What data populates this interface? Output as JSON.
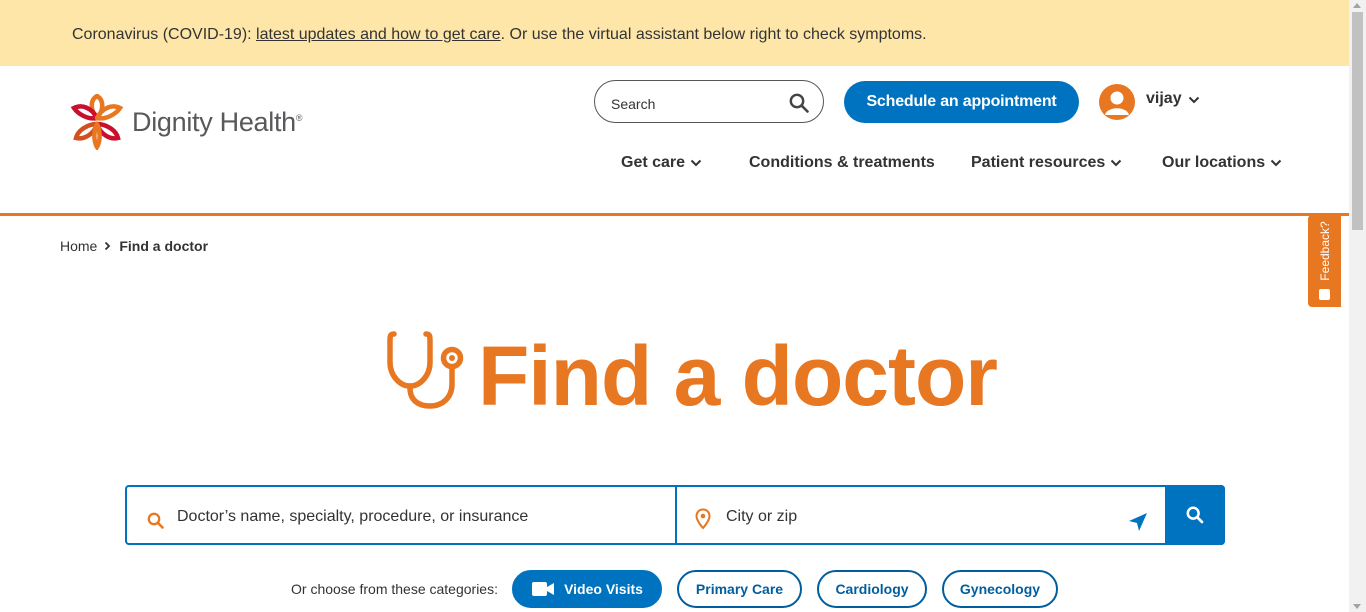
{
  "alert": {
    "prefix": "Coronavirus (COVID-19): ",
    "link": "latest updates and how to get care",
    "suffix": ". Or use the virtual assistant below right to check symptoms."
  },
  "header": {
    "logo_text": "Dignity Health",
    "logo_mark": "®",
    "search_placeholder": "Search",
    "schedule_label": "Schedule an appointment",
    "user_name": "vijay",
    "nav": [
      {
        "label": "Get care",
        "has_dropdown": true
      },
      {
        "label": "Conditions & treatments",
        "has_dropdown": false
      },
      {
        "label": "Patient resources",
        "has_dropdown": true
      },
      {
        "label": "Our locations",
        "has_dropdown": true
      }
    ]
  },
  "breadcrumb": {
    "home": "Home",
    "current": "Find a doctor"
  },
  "hero": {
    "title": "Find a doctor",
    "icon": "stethoscope-icon"
  },
  "find_bar": {
    "query_placeholder": "Doctor’s name, specialty, procedure, or insurance",
    "location_placeholder": "City or zip"
  },
  "categories": {
    "label": "Or choose from these categories:",
    "chips": [
      {
        "label": "Video Visits",
        "icon": "video-camera-icon",
        "selected": true
      },
      {
        "label": "Primary Care",
        "selected": false
      },
      {
        "label": "Cardiology",
        "selected": false
      },
      {
        "label": "Gynecology",
        "selected": false
      }
    ]
  },
  "feedback": {
    "label": "Feedback?"
  },
  "colors": {
    "accent_orange": "#e87722",
    "brand_blue": "#0073c0",
    "alert_bg": "#fde6a8"
  }
}
